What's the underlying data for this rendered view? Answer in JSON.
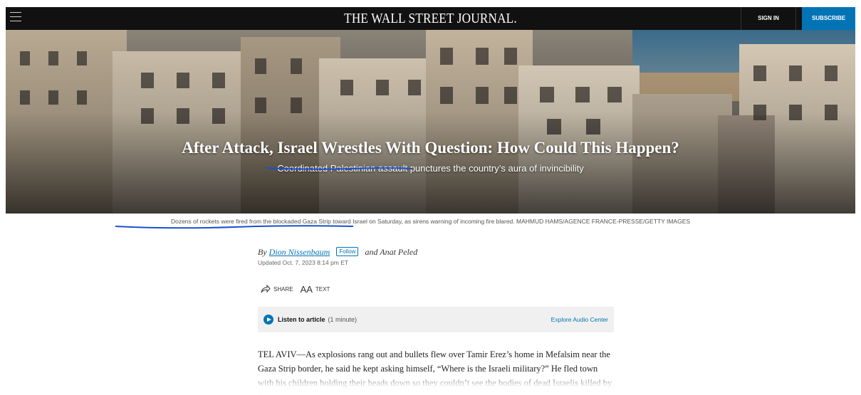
{
  "header": {
    "masthead": "THE WALL STREET JOURNAL.",
    "sign_in": "SIGN IN",
    "subscribe": "SUBSCRIBE"
  },
  "hero": {
    "headline": "After Attack, Israel Wrestles With Question: How Could This Happen?",
    "dek": "Coordinated Palestinian assault punctures the country’s aura of invincibility"
  },
  "caption": {
    "text": "Dozens of rockets were fired from the blockaded Gaza Strip toward Israel on Saturday, as sirens warning of incoming fire blared. MAHMUD HAMS/AGENCE FRANCE-PRESSE/GETTY IMAGES"
  },
  "byline": {
    "by": "By",
    "author1": "Dion Nissenbaum",
    "follow": "Follow",
    "and_author2": "and Anat Peled",
    "updated": "Updated Oct. 7, 2023 8:14 pm ET"
  },
  "tools": {
    "share": "SHARE",
    "text_icon": "AA",
    "text": "TEXT"
  },
  "audio": {
    "listen_label": "Listen to article",
    "duration": "(1 minute)",
    "explore": "Explore Audio Center"
  },
  "article": {
    "body": "TEL AVIV—As explosions rang out and bullets flew over Tamir Erez’s home in Mefalsim near the Gaza Strip border, he said he kept asking himself, “Where is the Israeli military?” He fled town with his children holding their heads down so they couldn’t see the bodies of dead Israelis killed by Palestinian militants."
  },
  "colors": {
    "brand_blue": "#0274b6",
    "topbar_bg": "#111111",
    "annotation_underline": "#1a4fcf"
  },
  "icons": [
    "menu-icon",
    "share-icon",
    "text-size-icon",
    "play-icon"
  ]
}
